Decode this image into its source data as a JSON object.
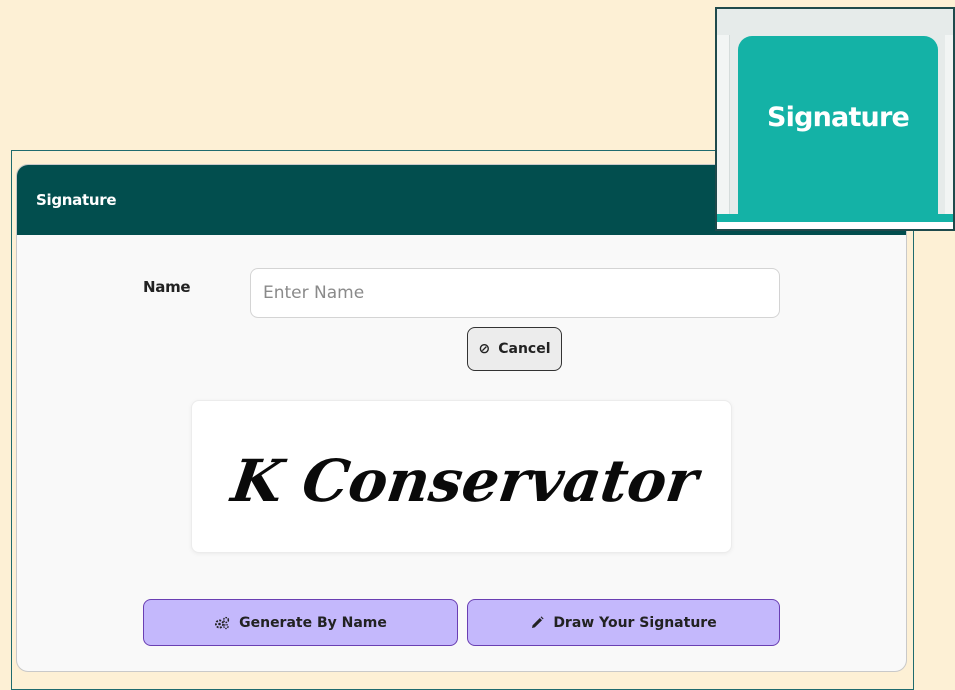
{
  "dialog": {
    "title": "Signature",
    "name_label": "Name",
    "name_input": {
      "placeholder": "Enter Name",
      "value": ""
    },
    "cancel_button": {
      "label": "Cancel",
      "icon": "ban-icon"
    },
    "signature_preview": {
      "text": "K Conservator"
    },
    "generate_button": {
      "label": "Generate By Name",
      "icon": "gears-icon"
    },
    "draw_button": {
      "label": "Draw Your Signature",
      "icon": "pencil-icon"
    }
  },
  "zoom_inset": {
    "tab_label": "Signature"
  },
  "colors": {
    "page_background": "#fdf0d5",
    "header": "#024e4e",
    "tab_accent": "#14b2a6",
    "button_purple": "#c4b8fc",
    "button_purple_border": "#6a3fb3"
  }
}
